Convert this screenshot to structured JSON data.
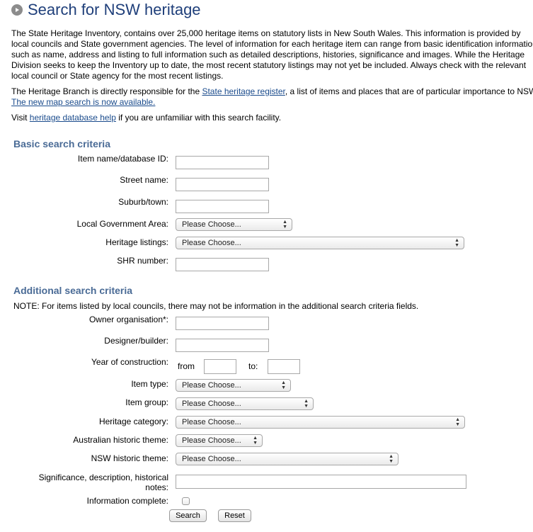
{
  "header": {
    "title": "Search for NSW heritage"
  },
  "intro": {
    "line1": "The State Heritage Inventory, contains over 25,000 heritage items on statutory lists in New South Wales. This information is provided by",
    "line2": "local councils and State government agencies. The level of information for each heritage item can range from basic identification information",
    "line3": "such as name, address and listing to full information such as detailed descriptions, histories, significance and images. While the Heritage",
    "line4": "Division seeks to keep the Inventory up to date, the most recent statutory listings may not yet be included. Always check with the relevant",
    "line5": "local council or State agency for the most recent listings.",
    "branch_prefix": "The Heritage Branch is directly responsible for the ",
    "register_link": "State heritage register",
    "branch_suffix": ", a list of items and places that are of particular importance to NSW",
    "map_link": "The new map search is now available.",
    "visit_prefix": "Visit ",
    "help_link": "heritage database help",
    "visit_suffix": " if you are unfamiliar with this search facility."
  },
  "basic": {
    "heading": "Basic search criteria",
    "item_name_label": "Item name/database ID:",
    "street_label": "Street name:",
    "suburb_label": "Suburb/town:",
    "lga_label": "Local Government Area:",
    "lga_value": "Please Choose...",
    "listings_label": "Heritage listings:",
    "listings_value": "Please Choose...",
    "shr_label": "SHR number:"
  },
  "additional": {
    "heading": "Additional search criteria",
    "note": "NOTE: For items listed by local councils, there may not be information in the additional search criteria fields.",
    "owner_label": "Owner organisation*:",
    "designer_label": "Designer/builder:",
    "year_label": "Year of construction:",
    "from_label": "from",
    "to_label": "to:",
    "item_type_label": "Item type:",
    "item_type_value": "Please Choose...",
    "item_group_label": "Item group:",
    "item_group_value": "Please Choose...",
    "category_label": "Heritage category:",
    "category_value": "Please Choose...",
    "aus_theme_label": "Australian historic theme:",
    "aus_theme_value": "Please Choose...",
    "nsw_theme_label": "NSW historic theme:",
    "nsw_theme_value": "Please Choose...",
    "significance_label": "Significance, description, historical notes:",
    "complete_label": "Information complete:"
  },
  "buttons": {
    "search": "Search",
    "reset": "Reset"
  },
  "colors": {
    "title": "#1f3f7a",
    "section_heading": "#4a6b96",
    "link": "#1a4b8c"
  },
  "icons": {
    "title_bullet": "play-circle-icon",
    "select_arrows": "updown-arrows-icon"
  }
}
